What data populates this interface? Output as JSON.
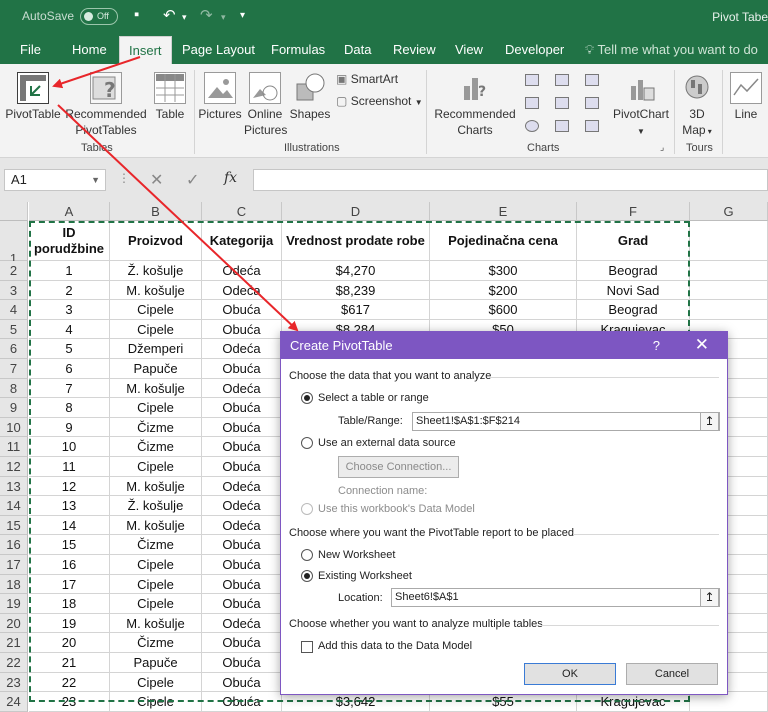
{
  "window": {
    "autosave_label": "AutoSave",
    "autosave_state": "Off",
    "title": "Pivot Tabe"
  },
  "tabs": [
    "File",
    "Home",
    "Insert",
    "Page Layout",
    "Formulas",
    "Data",
    "Review",
    "View",
    "Developer"
  ],
  "active_tab": "Insert",
  "tell_me": "Tell me what you want to do",
  "ribbon": {
    "pivottable": "PivotTable",
    "recommended_pivottables": [
      "Recommended",
      "PivotTables"
    ],
    "table": "Table",
    "tables_group": "Tables",
    "pictures": "Pictures",
    "online_pictures": [
      "Online",
      "Pictures"
    ],
    "shapes": "Shapes",
    "smartart": "SmartArt",
    "screenshot": "Screenshot",
    "illustrations_group": "Illustrations",
    "recommended_charts": [
      "Recommended",
      "Charts"
    ],
    "pivotchart": "PivotChart",
    "charts_group": "Charts",
    "map_3d": [
      "3D",
      "Map"
    ],
    "tours_group": "Tours",
    "line": "Line"
  },
  "formula_bar": {
    "name_box": "A1",
    "fx": "fx",
    "cancel": "✕",
    "enter": "✓"
  },
  "sheet": {
    "columns": [
      "A",
      "B",
      "C",
      "D",
      "E",
      "F",
      "G"
    ],
    "headers": [
      "ID porudžbine",
      "Proizvod",
      "Kategorija",
      "Vrednost prodate robe",
      "Pojedinačna cena",
      "Grad"
    ],
    "rows": [
      [
        "1",
        "Ž. košulje",
        "Odeća",
        "$4,270",
        "$300",
        "Beograd"
      ],
      [
        "2",
        "M. košulje",
        "Odeća",
        "$8,239",
        "$200",
        "Novi Sad"
      ],
      [
        "3",
        "Cipele",
        "Obuća",
        "$617",
        "$600",
        "Beograd"
      ],
      [
        "4",
        "Cipele",
        "Obuća",
        "$8,284",
        "$50",
        "Kragujevac"
      ],
      [
        "5",
        "Džemperi",
        "Odeća",
        "",
        "",
        ""
      ],
      [
        "6",
        "Papuče",
        "Obuća",
        "",
        "",
        ""
      ],
      [
        "7",
        "M. košulje",
        "Odeća",
        "",
        "",
        ""
      ],
      [
        "8",
        "Cipele",
        "Obuća",
        "",
        "",
        ""
      ],
      [
        "9",
        "Čizme",
        "Obuća",
        "",
        "",
        ""
      ],
      [
        "10",
        "Čizme",
        "Obuća",
        "",
        "",
        ""
      ],
      [
        "11",
        "Cipele",
        "Obuća",
        "",
        "",
        ""
      ],
      [
        "12",
        "M. košulje",
        "Odeća",
        "",
        "",
        ""
      ],
      [
        "13",
        "Ž. košulje",
        "Odeća",
        "",
        "",
        ""
      ],
      [
        "14",
        "M. košulje",
        "Odeća",
        "",
        "",
        ""
      ],
      [
        "15",
        "Čizme",
        "Obuća",
        "",
        "",
        ""
      ],
      [
        "16",
        "Cipele",
        "Obuća",
        "",
        "",
        ""
      ],
      [
        "17",
        "Cipele",
        "Obuća",
        "",
        "",
        ""
      ],
      [
        "18",
        "Cipele",
        "Obuća",
        "",
        "",
        ""
      ],
      [
        "19",
        "M. košulje",
        "Odeća",
        "",
        "",
        ""
      ],
      [
        "20",
        "Čizme",
        "Obuća",
        "",
        "",
        ""
      ],
      [
        "21",
        "Papuče",
        "Obuća",
        "",
        "",
        ""
      ],
      [
        "22",
        "Cipele",
        "Obuća",
        "",
        "",
        ""
      ],
      [
        "23",
        "Cipele",
        "Obuća",
        "$3,642",
        "$55",
        "Kragujevac"
      ]
    ]
  },
  "dialog": {
    "title": "Create PivotTable",
    "help": "?",
    "close": "✕",
    "section1": "Choose the data that you want to analyze",
    "opt_select_table": "Select a table or range",
    "table_range_label": "Table/Range:",
    "table_range_value": "Sheet1!$A$1:$F$214",
    "opt_external": "Use an external data source",
    "choose_connection": "Choose Connection...",
    "connection_name": "Connection name:",
    "opt_data_model": "Use this workbook's Data Model",
    "section2": "Choose where you want the PivotTable report to be placed",
    "opt_new_ws": "New Worksheet",
    "opt_existing_ws": "Existing Worksheet",
    "location_label": "Location:",
    "location_value": "Sheet6!$A$1",
    "section3": "Choose whether you want to analyze multiple tables",
    "add_data_model": "Add this data to the Data Model",
    "ok": "OK",
    "cancel": "Cancel",
    "range_button": "↥"
  },
  "colors": {
    "excel_green": "#217346",
    "dialog_purple": "#7d56c2",
    "arrow_red": "#e8262a"
  }
}
